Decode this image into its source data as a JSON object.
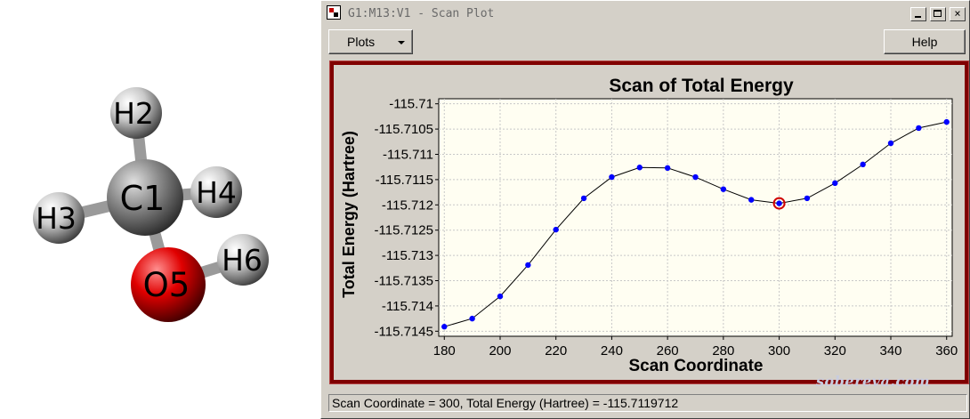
{
  "molecule": {
    "atoms": [
      {
        "label": "H2",
        "color": "#c8c8c8"
      },
      {
        "label": "C1",
        "color": "#8a8a8a"
      },
      {
        "label": "H4",
        "color": "#c8c8c8"
      },
      {
        "label": "H3",
        "color": "#c8c8c8"
      },
      {
        "label": "H6",
        "color": "#c8c8c8"
      },
      {
        "label": "O5",
        "color": "#e00000"
      }
    ]
  },
  "window": {
    "title": "G1:M13:V1 - Scan Plot",
    "toolbar": {
      "plots_label": "Plots",
      "help_label": "Help"
    },
    "status": "Scan Coordinate = 300, Total Energy (Hartree) = -115.7119712"
  },
  "watermark": "sobereva.com",
  "chart_data": {
    "type": "line",
    "title": "Scan of Total Energy",
    "xlabel": "Scan Coordinate",
    "ylabel": "Total Energy (Hartree)",
    "xlim": [
      178,
      362
    ],
    "ylim": [
      -115.7146,
      -115.7099
    ],
    "xticks": [
      180,
      200,
      220,
      240,
      260,
      280,
      300,
      320,
      340,
      360
    ],
    "yticks": [
      -115.71,
      -115.7105,
      -115.711,
      -115.7115,
      -115.712,
      -115.7125,
      -115.713,
      -115.7135,
      -115.714,
      -115.7145
    ],
    "yticklabels": [
      "-115.71",
      "-115.7105",
      "-115.711",
      "-115.7115",
      "-115.712",
      "-115.7125",
      "-115.713",
      "-115.7135",
      "-115.714",
      "-115.7145"
    ],
    "grid": true,
    "selected_x": 300,
    "point_color": "#0000ff",
    "selected_color": "#d00000",
    "x": [
      180,
      190,
      200,
      210,
      220,
      230,
      240,
      250,
      260,
      270,
      280,
      290,
      300,
      310,
      320,
      330,
      340,
      350,
      360
    ],
    "y": [
      -115.71441,
      -115.71425,
      -115.71381,
      -115.71319,
      -115.71249,
      -115.71187,
      -115.71145,
      -115.71126,
      -115.71127,
      -115.71145,
      -115.71169,
      -115.7119,
      -115.71197,
      -115.71187,
      -115.71157,
      -115.7112,
      -115.71078,
      -115.71048,
      -115.71036
    ]
  }
}
